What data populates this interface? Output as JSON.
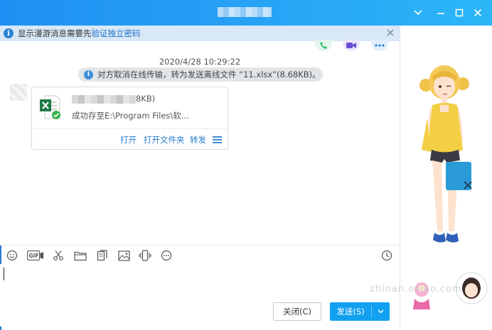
{
  "window": {
    "controls": [
      "chevron-down-icon",
      "minimize-icon",
      "maximize-icon",
      "close-icon"
    ]
  },
  "notice": {
    "text": "显示漫游消息需要先",
    "link": "验证独立密码"
  },
  "chat": {
    "timestamp": "2020/4/28 10:29:22",
    "system_message": "对方取消在线传输，转为发送离线文件 “11.xlsx”(8.68KB)。",
    "file_card": {
      "size_tail": "8KB)",
      "status": "成功存至E:\\Program Files\\软...",
      "actions": {
        "open": "打开",
        "open_folder": "打开文件夹",
        "forward": "转发"
      }
    }
  },
  "toolbar": {
    "gif_label": "GIF"
  },
  "buttons": {
    "close": "关闭(C)",
    "send": "发送(S)"
  },
  "watermark": "zhinan.oxiao.com",
  "colors": {
    "titlebar": "#1e90f3",
    "notice_bg": "#d9e8f7",
    "link": "#1a6fc9",
    "send_button": "#12a0f0",
    "excel_green": "#1f7a45",
    "success_green": "#34b34a"
  }
}
